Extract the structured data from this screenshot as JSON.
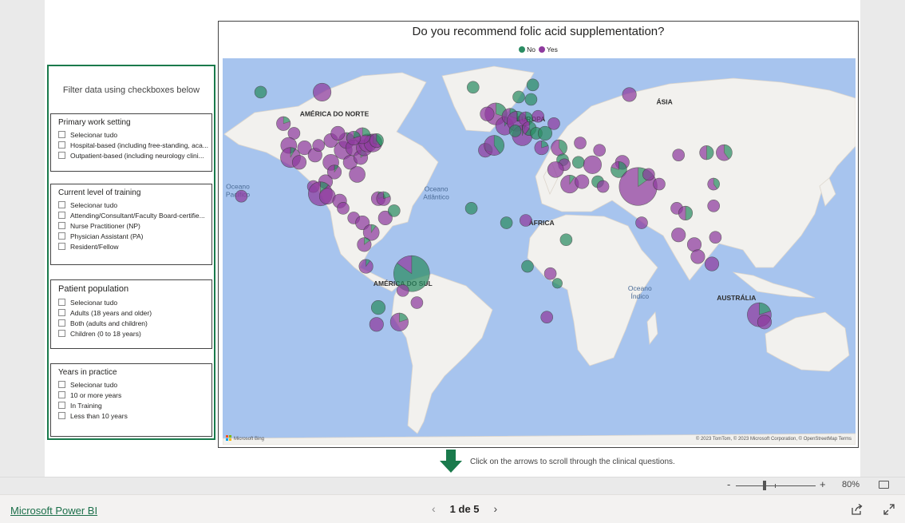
{
  "filter_panel": {
    "heading": "Filter data using checkboxes below",
    "slicers": [
      {
        "title": "Primary work setting",
        "options": [
          "Selecionar tudo",
          "Hospital-based (including free-standing, aca...",
          "Outpatient-based (including neurology clini..."
        ]
      },
      {
        "title": "Current level of training",
        "options": [
          "Selecionar tudo",
          "Attending/Consultant/Faculty Board-certifie...",
          "Nurse Practitioner (NP)",
          "Physician Assistant (PA)",
          "Resident/Fellow"
        ]
      },
      {
        "title": "Patient population",
        "options": [
          "Selecionar tudo",
          "Adults (18 years and older)",
          "Both (adults and children)",
          "Children (0 to 18 years)"
        ]
      },
      {
        "title": "Years in practice",
        "options": [
          "Selecionar tudo",
          "10 or more years",
          "In Training",
          "Less than 10 years"
        ]
      }
    ]
  },
  "map_visual": {
    "title": "Do you recommend folic acid supplementation?",
    "legend": [
      {
        "label": "No",
        "color": "#2b8c63"
      },
      {
        "label": "Yes",
        "color": "#8e3b9e"
      }
    ],
    "region_labels": [
      {
        "text": "AMÉRICA DO NORTE",
        "lon": -95,
        "lat": 52
      },
      {
        "text": "EUROPA",
        "lon": 17,
        "lat": 50
      },
      {
        "text": "ÁSIA",
        "lon": 93,
        "lat": 57
      },
      {
        "text": "ÁFRICA",
        "lon": 23,
        "lat": 7
      },
      {
        "text": "AMÉRICA DO SUL",
        "lon": -56,
        "lat": -18
      },
      {
        "text": "AUSTRÁLIA",
        "lon": 134,
        "lat": -24
      }
    ],
    "ocean_labels": [
      {
        "text": "Oceano\nPacífico",
        "lon": -150,
        "lat": 22
      },
      {
        "text": "Oceano\nAtlântico",
        "lon": -37,
        "lat": 21
      },
      {
        "text": "Oceano\nÍndico",
        "lon": 79,
        "lat": -20
      }
    ],
    "attribution_left": "Microsoft Bing",
    "attribution_right": "© 2023 TomTom, © 2023 Microsoft Corporation, © OpenStreetMap   Terms",
    "bubbles": [
      {
        "lon": -137,
        "lat": 62,
        "size": 6,
        "yes_frac": 0.0
      },
      {
        "lon": -102,
        "lat": 62,
        "size": 9,
        "yes_frac": 1.0
      },
      {
        "lon": -124,
        "lat": 49,
        "size": 7,
        "yes_frac": 0.8
      },
      {
        "lon": -118,
        "lat": 45,
        "size": 6,
        "yes_frac": 1.0
      },
      {
        "lon": -121,
        "lat": 40,
        "size": 8,
        "yes_frac": 1.0
      },
      {
        "lon": -120,
        "lat": 35,
        "size": 10,
        "yes_frac": 0.92
      },
      {
        "lon": -112,
        "lat": 39,
        "size": 7,
        "yes_frac": 1.0
      },
      {
        "lon": -115,
        "lat": 33,
        "size": 7,
        "yes_frac": 1.0
      },
      {
        "lon": -106,
        "lat": 36,
        "size": 7,
        "yes_frac": 1.0
      },
      {
        "lon": -104,
        "lat": 40,
        "size": 6,
        "yes_frac": 1.0
      },
      {
        "lon": -97,
        "lat": 42,
        "size": 7,
        "yes_frac": 1.0
      },
      {
        "lon": -97,
        "lat": 33,
        "size": 8,
        "yes_frac": 1.0
      },
      {
        "lon": -95,
        "lat": 29,
        "size": 7,
        "yes_frac": 0.9
      },
      {
        "lon": -90,
        "lat": 38,
        "size": 9,
        "yes_frac": 1.0
      },
      {
        "lon": -88,
        "lat": 42,
        "size": 8,
        "yes_frac": 0.8
      },
      {
        "lon": -86,
        "lat": 33,
        "size": 7,
        "yes_frac": 1.0
      },
      {
        "lon": -84,
        "lat": 39,
        "size": 8,
        "yes_frac": 1.0
      },
      {
        "lon": -82,
        "lat": 28,
        "size": 8,
        "yes_frac": 1.0
      },
      {
        "lon": -80,
        "lat": 35,
        "size": 7,
        "yes_frac": 0.85
      },
      {
        "lon": -78,
        "lat": 39,
        "size": 8,
        "yes_frac": 1.0
      },
      {
        "lon": -76,
        "lat": 41,
        "size": 9,
        "yes_frac": 0.9
      },
      {
        "lon": -73,
        "lat": 41,
        "size": 9,
        "yes_frac": 0.7
      },
      {
        "lon": -71,
        "lat": 42,
        "size": 7,
        "yes_frac": 0.6
      },
      {
        "lon": -79,
        "lat": 44,
        "size": 8,
        "yes_frac": 0.75
      },
      {
        "lon": -84,
        "lat": 43,
        "size": 7,
        "yes_frac": 0.8
      },
      {
        "lon": -93,
        "lat": 45,
        "size": 7,
        "yes_frac": 1.0
      },
      {
        "lon": -107,
        "lat": 23,
        "size": 6,
        "yes_frac": 1.0
      },
      {
        "lon": -100,
        "lat": 25,
        "size": 7,
        "yes_frac": 1.0
      },
      {
        "lon": -103,
        "lat": 20,
        "size": 12,
        "yes_frac": 0.88
      },
      {
        "lon": -99,
        "lat": 19,
        "size": 8,
        "yes_frac": 1.0
      },
      {
        "lon": -92,
        "lat": 17,
        "size": 7,
        "yes_frac": 1.0
      },
      {
        "lon": -148,
        "lat": 19,
        "size": 6,
        "yes_frac": 1.0
      },
      {
        "lon": -90,
        "lat": 14,
        "size": 6,
        "yes_frac": 1.0
      },
      {
        "lon": -84,
        "lat": 10,
        "size": 6,
        "yes_frac": 1.0
      },
      {
        "lon": -79,
        "lat": 8,
        "size": 7,
        "yes_frac": 1.0
      },
      {
        "lon": -70,
        "lat": 18,
        "size": 7,
        "yes_frac": 0.8
      },
      {
        "lon": -67,
        "lat": 18,
        "size": 7,
        "yes_frac": 0.8
      },
      {
        "lon": -66,
        "lat": 10,
        "size": 7,
        "yes_frac": 1.0
      },
      {
        "lon": -61,
        "lat": 13,
        "size": 6,
        "yes_frac": 0.0
      },
      {
        "lon": -74,
        "lat": 4,
        "size": 8,
        "yes_frac": 0.9
      },
      {
        "lon": -78,
        "lat": -1,
        "size": 7,
        "yes_frac": 0.85
      },
      {
        "lon": -77,
        "lat": -10,
        "size": 7,
        "yes_frac": 0.9
      },
      {
        "lon": -51,
        "lat": -13,
        "size": 18,
        "yes_frac": 0.15
      },
      {
        "lon": -56,
        "lat": -20,
        "size": 6,
        "yes_frac": 1.0
      },
      {
        "lon": -48,
        "lat": -25,
        "size": 6,
        "yes_frac": 1.0
      },
      {
        "lon": -70,
        "lat": -27,
        "size": 7,
        "yes_frac": 0.0
      },
      {
        "lon": -58,
        "lat": -33,
        "size": 9,
        "yes_frac": 0.8
      },
      {
        "lon": -71,
        "lat": -34,
        "size": 7,
        "yes_frac": 1.0
      },
      {
        "lon": -16,
        "lat": 64,
        "size": 6,
        "yes_frac": 0.0
      },
      {
        "lon": -3,
        "lat": 53,
        "size": 11,
        "yes_frac": 0.7
      },
      {
        "lon": -8,
        "lat": 53,
        "size": 7,
        "yes_frac": 1.0
      },
      {
        "lon": 10,
        "lat": 60,
        "size": 6,
        "yes_frac": 0.0
      },
      {
        "lon": 18,
        "lat": 65,
        "size": 6,
        "yes_frac": 0.0
      },
      {
        "lon": 17,
        "lat": 59,
        "size": 6,
        "yes_frac": 0.0
      },
      {
        "lon": 2,
        "lat": 48,
        "size": 9,
        "yes_frac": 0.9
      },
      {
        "lon": 5,
        "lat": 52,
        "size": 8,
        "yes_frac": 0.7
      },
      {
        "lon": 9,
        "lat": 50,
        "size": 10,
        "yes_frac": 0.8
      },
      {
        "lon": 14,
        "lat": 51,
        "size": 7,
        "yes_frac": 0.6
      },
      {
        "lon": 21,
        "lat": 52,
        "size": 6,
        "yes_frac": 1.0
      },
      {
        "lon": 12,
        "lat": 44,
        "size": 10,
        "yes_frac": 0.95
      },
      {
        "lon": 8,
        "lat": 46,
        "size": 6,
        "yes_frac": 0.0
      },
      {
        "lon": -9,
        "lat": 38,
        "size": 7,
        "yes_frac": 0.7
      },
      {
        "lon": -4,
        "lat": 40,
        "size": 10,
        "yes_frac": 0.6
      },
      {
        "lon": 16,
        "lat": 47,
        "size": 7,
        "yes_frac": 0.4
      },
      {
        "lon": 20,
        "lat": 45,
        "size": 6,
        "yes_frac": 0.0
      },
      {
        "lon": 25,
        "lat": 45,
        "size": 7,
        "yes_frac": 0.0
      },
      {
        "lon": 30,
        "lat": 49,
        "size": 6,
        "yes_frac": 1.0
      },
      {
        "lon": 23,
        "lat": 39,
        "size": 7,
        "yes_frac": 0.8
      },
      {
        "lon": 33,
        "lat": 39,
        "size": 8,
        "yes_frac": 0.6
      },
      {
        "lon": 45,
        "lat": 41,
        "size": 6,
        "yes_frac": 1.0
      },
      {
        "lon": 35,
        "lat": 34,
        "size": 6,
        "yes_frac": 0.0
      },
      {
        "lon": 36,
        "lat": 32,
        "size": 6,
        "yes_frac": 1.0
      },
      {
        "lon": 39,
        "lat": 24,
        "size": 9,
        "yes_frac": 0.9
      },
      {
        "lon": 46,
        "lat": 25,
        "size": 7,
        "yes_frac": 1.0
      },
      {
        "lon": 31,
        "lat": 30,
        "size": 8,
        "yes_frac": 1.0
      },
      {
        "lon": 44,
        "lat": 33,
        "size": 6,
        "yes_frac": 0.0
      },
      {
        "lon": 52,
        "lat": 32,
        "size": 9,
        "yes_frac": 1.0
      },
      {
        "lon": 55,
        "lat": 25,
        "size": 6,
        "yes_frac": 0.0
      },
      {
        "lon": 58,
        "lat": 23,
        "size": 6,
        "yes_frac": 1.0
      },
      {
        "lon": 56,
        "lat": 38,
        "size": 6,
        "yes_frac": 1.0
      },
      {
        "lon": 69,
        "lat": 33,
        "size": 7,
        "yes_frac": 1.0
      },
      {
        "lon": 67,
        "lat": 30,
        "size": 8,
        "yes_frac": 0.2
      },
      {
        "lon": 78,
        "lat": 23,
        "size": 19,
        "yes_frac": 0.85
      },
      {
        "lon": 80,
        "lat": 8,
        "size": 6,
        "yes_frac": 1.0
      },
      {
        "lon": 90,
        "lat": 24,
        "size": 6,
        "yes_frac": 1.0
      },
      {
        "lon": 84,
        "lat": 28,
        "size": 6,
        "yes_frac": 1.0
      },
      {
        "lon": 73,
        "lat": 61,
        "size": 7,
        "yes_frac": 1.0
      },
      {
        "lon": 101,
        "lat": 36,
        "size": 6,
        "yes_frac": 1.0
      },
      {
        "lon": 117,
        "lat": 37,
        "size": 7,
        "yes_frac": 0.5
      },
      {
        "lon": 127,
        "lat": 37,
        "size": 8,
        "yes_frac": 0.6
      },
      {
        "lon": 121,
        "lat": 24,
        "size": 6,
        "yes_frac": 0.6
      },
      {
        "lon": 121,
        "lat": 15,
        "size": 6,
        "yes_frac": 1.0
      },
      {
        "lon": 100,
        "lat": 14,
        "size": 6,
        "yes_frac": 1.0
      },
      {
        "lon": 105,
        "lat": 12,
        "size": 7,
        "yes_frac": 0.5
      },
      {
        "lon": 101,
        "lat": 3,
        "size": 7,
        "yes_frac": 1.0
      },
      {
        "lon": 110,
        "lat": -1,
        "size": 7,
        "yes_frac": 1.0
      },
      {
        "lon": 112,
        "lat": -6,
        "size": 7,
        "yes_frac": 1.0
      },
      {
        "lon": 122,
        "lat": 2,
        "size": 6,
        "yes_frac": 1.0
      },
      {
        "lon": 120,
        "lat": -9,
        "size": 7,
        "yes_frac": 1.0
      },
      {
        "lon": -17,
        "lat": 14,
        "size": 6,
        "yes_frac": 0.0
      },
      {
        "lon": 3,
        "lat": 8,
        "size": 6,
        "yes_frac": 0.0
      },
      {
        "lon": 14,
        "lat": 9,
        "size": 6,
        "yes_frac": 1.0
      },
      {
        "lon": 37,
        "lat": 1,
        "size": 6,
        "yes_frac": 0.0
      },
      {
        "lon": 15,
        "lat": -10,
        "size": 6,
        "yes_frac": 0.0
      },
      {
        "lon": 28,
        "lat": -13,
        "size": 6,
        "yes_frac": 1.0
      },
      {
        "lon": 32,
        "lat": -17,
        "size": 5,
        "yes_frac": 0.0
      },
      {
        "lon": 26,
        "lat": -31,
        "size": 6,
        "yes_frac": 1.0
      },
      {
        "lon": 147,
        "lat": -30,
        "size": 12,
        "yes_frac": 0.8
      },
      {
        "lon": 150,
        "lat": -33,
        "size": 7,
        "yes_frac": 1.0
      }
    ]
  },
  "scroll_hint": "Click on the arrows to scroll through the clinical questions.",
  "zoom": {
    "minus": "-",
    "plus": "+",
    "percent": "80%",
    "level": 0.36
  },
  "footer": {
    "brand": "Microsoft Power BI",
    "page_text": "1 de 5",
    "prev": "‹",
    "next": "›"
  }
}
